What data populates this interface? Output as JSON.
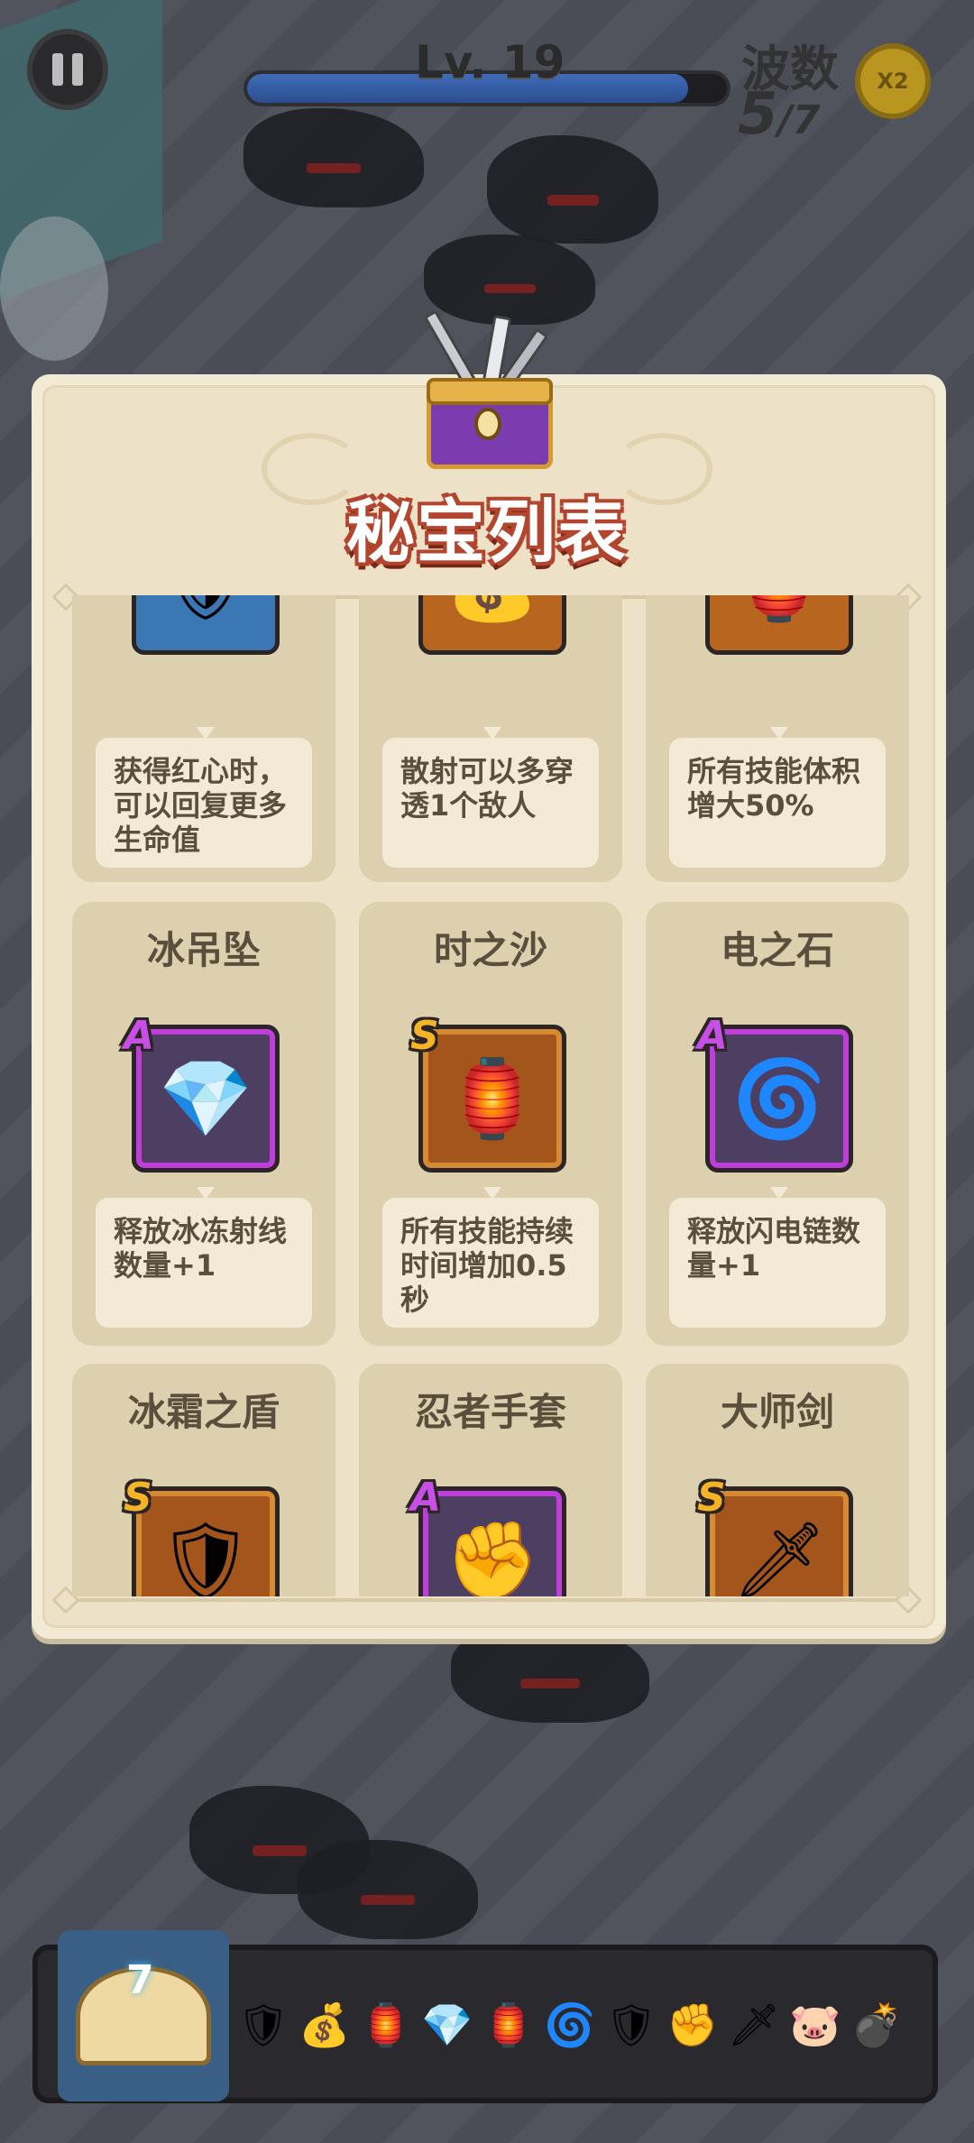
{
  "hud": {
    "level": "Lv. 19",
    "xp_progress": 0.92,
    "wave_label": "波数",
    "wave_current": "5",
    "wave_total": "/7",
    "speed_label": "X2"
  },
  "modal": {
    "title": "秘宝列表"
  },
  "rows": [
    {
      "items": [
        {
          "name": "",
          "rank": "",
          "icon": "armor-icon",
          "desc": "获得红心时，可以回复更多生命值"
        },
        {
          "name": "",
          "rank": "",
          "icon": "pouch-icon",
          "desc": "散射可以多穿透1个敌人"
        },
        {
          "name": "",
          "rank": "",
          "icon": "lantern-icon",
          "desc": "所有技能体积增大50%"
        }
      ]
    },
    {
      "items": [
        {
          "name": "冰吊坠",
          "rank": "A",
          "icon": "pendant-icon",
          "desc": "释放冰冻射线数量+1"
        },
        {
          "name": "时之沙",
          "rank": "S",
          "icon": "lantern-icon",
          "desc": "所有技能持续时间增加0.5秒"
        },
        {
          "name": "电之石",
          "rank": "A",
          "icon": "rune-stone-icon",
          "desc": "释放闪电链数量+1"
        }
      ]
    },
    {
      "items": [
        {
          "name": "冰霜之盾",
          "rank": "S",
          "icon": "shield-icon",
          "desc": ""
        },
        {
          "name": "忍者手套",
          "rank": "A",
          "icon": "gauntlet-icon",
          "desc": ""
        },
        {
          "name": "大师剑",
          "rank": "S",
          "icon": "sword-icon",
          "desc": ""
        }
      ]
    }
  ],
  "bottom_bar": {
    "book_level": "7",
    "slots": [
      "armor-icon",
      "pouch-icon",
      "lantern-icon",
      "pendant-icon",
      "lantern-icon",
      "rune-stone-icon",
      "shield-icon",
      "gauntlet-icon",
      "sword-icon",
      "piggy-bank-icon",
      "cannon-icon"
    ]
  }
}
